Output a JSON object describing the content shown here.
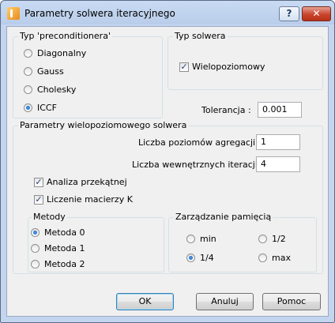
{
  "window": {
    "title": "Parametry solwera iteracyjnego",
    "help_label": "?",
    "close_label": "✕"
  },
  "preconditioner": {
    "legend": "Typ 'preconditionera'",
    "options": [
      "Diagonalny",
      "Gauss",
      "Cholesky",
      "ICCF"
    ],
    "selected": "ICCF"
  },
  "solver_type": {
    "legend": "Typ solwera",
    "multilevel_label": "Wielopoziomowy",
    "multilevel_checked": true
  },
  "tolerance": {
    "label": "Tolerancja :",
    "value": "0.001"
  },
  "multilevel": {
    "legend": "Parametry wielopoziomowego solwera",
    "aggregation_levels_label": "Liczba poziomów agregacji :",
    "aggregation_levels_value": "1",
    "inner_iterations_label": "Liczba wewnętrznych iteracji :",
    "inner_iterations_value": "4",
    "diagonal_analysis_label": "Analiza przekątnej",
    "diagonal_analysis_checked": true,
    "matrix_k_label": "Liczenie macierzy K",
    "matrix_k_checked": true
  },
  "methods": {
    "legend": "Metody",
    "options": [
      "Metoda 0",
      "Metoda 1",
      "Metoda 2"
    ],
    "selected": "Metoda 0"
  },
  "memory": {
    "legend": "Zarządzanie pamięcią",
    "options": [
      "min",
      "1/2",
      "1/4",
      "max"
    ],
    "selected": "1/4"
  },
  "buttons": {
    "ok": "OK",
    "cancel": "Anuluj",
    "help": "Pomoc"
  },
  "check_mark": "✓"
}
